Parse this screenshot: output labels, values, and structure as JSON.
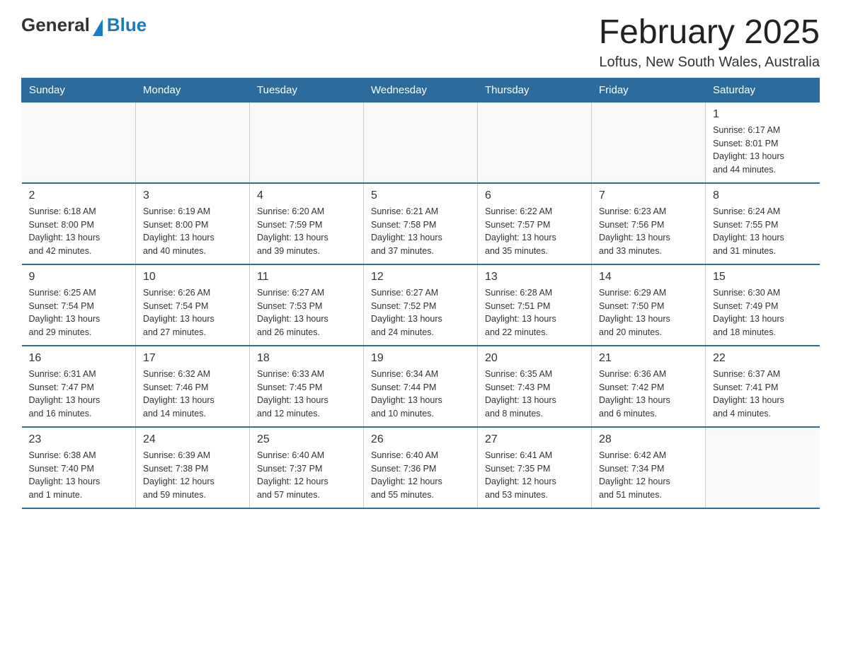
{
  "header": {
    "logo": {
      "general": "General",
      "blue": "Blue"
    },
    "title": "February 2025",
    "location": "Loftus, New South Wales, Australia"
  },
  "weekdays": [
    "Sunday",
    "Monday",
    "Tuesday",
    "Wednesday",
    "Thursday",
    "Friday",
    "Saturday"
  ],
  "weeks": [
    [
      {
        "day": "",
        "info": ""
      },
      {
        "day": "",
        "info": ""
      },
      {
        "day": "",
        "info": ""
      },
      {
        "day": "",
        "info": ""
      },
      {
        "day": "",
        "info": ""
      },
      {
        "day": "",
        "info": ""
      },
      {
        "day": "1",
        "info": "Sunrise: 6:17 AM\nSunset: 8:01 PM\nDaylight: 13 hours\nand 44 minutes."
      }
    ],
    [
      {
        "day": "2",
        "info": "Sunrise: 6:18 AM\nSunset: 8:00 PM\nDaylight: 13 hours\nand 42 minutes."
      },
      {
        "day": "3",
        "info": "Sunrise: 6:19 AM\nSunset: 8:00 PM\nDaylight: 13 hours\nand 40 minutes."
      },
      {
        "day": "4",
        "info": "Sunrise: 6:20 AM\nSunset: 7:59 PM\nDaylight: 13 hours\nand 39 minutes."
      },
      {
        "day": "5",
        "info": "Sunrise: 6:21 AM\nSunset: 7:58 PM\nDaylight: 13 hours\nand 37 minutes."
      },
      {
        "day": "6",
        "info": "Sunrise: 6:22 AM\nSunset: 7:57 PM\nDaylight: 13 hours\nand 35 minutes."
      },
      {
        "day": "7",
        "info": "Sunrise: 6:23 AM\nSunset: 7:56 PM\nDaylight: 13 hours\nand 33 minutes."
      },
      {
        "day": "8",
        "info": "Sunrise: 6:24 AM\nSunset: 7:55 PM\nDaylight: 13 hours\nand 31 minutes."
      }
    ],
    [
      {
        "day": "9",
        "info": "Sunrise: 6:25 AM\nSunset: 7:54 PM\nDaylight: 13 hours\nand 29 minutes."
      },
      {
        "day": "10",
        "info": "Sunrise: 6:26 AM\nSunset: 7:54 PM\nDaylight: 13 hours\nand 27 minutes."
      },
      {
        "day": "11",
        "info": "Sunrise: 6:27 AM\nSunset: 7:53 PM\nDaylight: 13 hours\nand 26 minutes."
      },
      {
        "day": "12",
        "info": "Sunrise: 6:27 AM\nSunset: 7:52 PM\nDaylight: 13 hours\nand 24 minutes."
      },
      {
        "day": "13",
        "info": "Sunrise: 6:28 AM\nSunset: 7:51 PM\nDaylight: 13 hours\nand 22 minutes."
      },
      {
        "day": "14",
        "info": "Sunrise: 6:29 AM\nSunset: 7:50 PM\nDaylight: 13 hours\nand 20 minutes."
      },
      {
        "day": "15",
        "info": "Sunrise: 6:30 AM\nSunset: 7:49 PM\nDaylight: 13 hours\nand 18 minutes."
      }
    ],
    [
      {
        "day": "16",
        "info": "Sunrise: 6:31 AM\nSunset: 7:47 PM\nDaylight: 13 hours\nand 16 minutes."
      },
      {
        "day": "17",
        "info": "Sunrise: 6:32 AM\nSunset: 7:46 PM\nDaylight: 13 hours\nand 14 minutes."
      },
      {
        "day": "18",
        "info": "Sunrise: 6:33 AM\nSunset: 7:45 PM\nDaylight: 13 hours\nand 12 minutes."
      },
      {
        "day": "19",
        "info": "Sunrise: 6:34 AM\nSunset: 7:44 PM\nDaylight: 13 hours\nand 10 minutes."
      },
      {
        "day": "20",
        "info": "Sunrise: 6:35 AM\nSunset: 7:43 PM\nDaylight: 13 hours\nand 8 minutes."
      },
      {
        "day": "21",
        "info": "Sunrise: 6:36 AM\nSunset: 7:42 PM\nDaylight: 13 hours\nand 6 minutes."
      },
      {
        "day": "22",
        "info": "Sunrise: 6:37 AM\nSunset: 7:41 PM\nDaylight: 13 hours\nand 4 minutes."
      }
    ],
    [
      {
        "day": "23",
        "info": "Sunrise: 6:38 AM\nSunset: 7:40 PM\nDaylight: 13 hours\nand 1 minute."
      },
      {
        "day": "24",
        "info": "Sunrise: 6:39 AM\nSunset: 7:38 PM\nDaylight: 12 hours\nand 59 minutes."
      },
      {
        "day": "25",
        "info": "Sunrise: 6:40 AM\nSunset: 7:37 PM\nDaylight: 12 hours\nand 57 minutes."
      },
      {
        "day": "26",
        "info": "Sunrise: 6:40 AM\nSunset: 7:36 PM\nDaylight: 12 hours\nand 55 minutes."
      },
      {
        "day": "27",
        "info": "Sunrise: 6:41 AM\nSunset: 7:35 PM\nDaylight: 12 hours\nand 53 minutes."
      },
      {
        "day": "28",
        "info": "Sunrise: 6:42 AM\nSunset: 7:34 PM\nDaylight: 12 hours\nand 51 minutes."
      },
      {
        "day": "",
        "info": ""
      }
    ]
  ]
}
